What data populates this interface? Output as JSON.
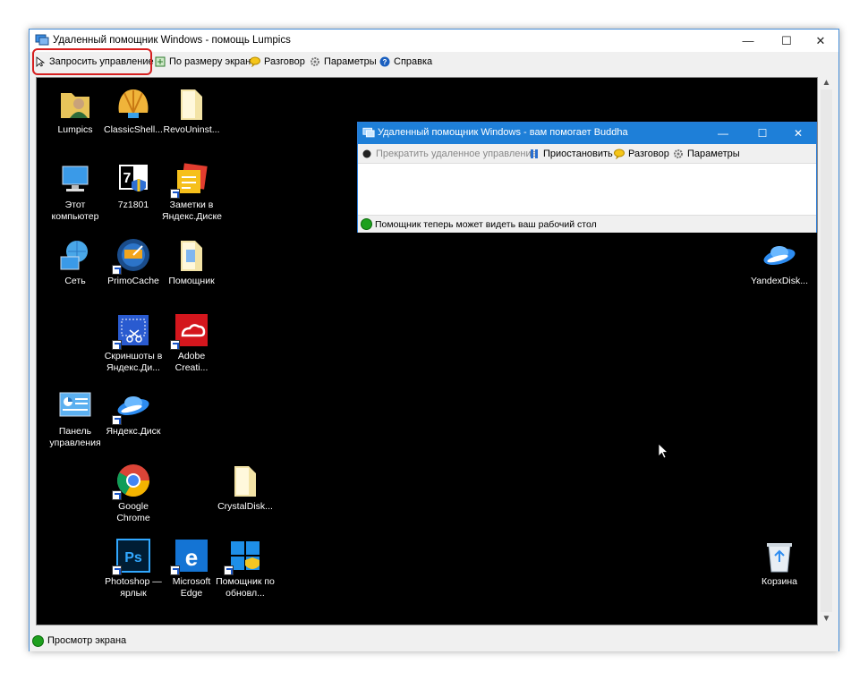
{
  "window": {
    "title": "Удаленный помощник Windows - помощь Lumpics",
    "minimize": "—",
    "maximize": "☐",
    "close": "✕"
  },
  "toolbar": {
    "request_control": "Запросить управление",
    "fit_screen": "По размеру экрана",
    "chat": "Разговор",
    "settings": "Параметры",
    "help": "Справка"
  },
  "status": {
    "text": "Просмотр экрана"
  },
  "desktop": {
    "icons": [
      {
        "label": "Lumpics"
      },
      {
        "label": "ClassicShell..."
      },
      {
        "label": "RevoUninst..."
      },
      {
        "label": "Этот компьютер"
      },
      {
        "label": "7z1801"
      },
      {
        "label": "Заметки в Яндекс.Диске"
      },
      {
        "label": "Сеть"
      },
      {
        "label": "PrimoCache"
      },
      {
        "label": "Помощник"
      },
      {
        "label": "Скриншоты в Яндекс.Ди..."
      },
      {
        "label": "Adobe Creati..."
      },
      {
        "label": "Панель управления"
      },
      {
        "label": "Яндекс.Диск"
      },
      {
        "label": "Google Chrome"
      },
      {
        "label": "CrystalDisk..."
      },
      {
        "label": "Photoshop — ярлык"
      },
      {
        "label": "Microsoft Edge"
      },
      {
        "label": "Помощник по обновл..."
      },
      {
        "label": "YandexDisk..."
      },
      {
        "label": "Корзина"
      }
    ]
  },
  "inner_window": {
    "title": "Удаленный помощник Windows - вам помогает Buddha",
    "stop_control": "Прекратить удаленное управление",
    "pause": "Приостановить",
    "chat": "Разговор",
    "settings": "Параметры",
    "status": "Помощник теперь может видеть ваш рабочий стол"
  },
  "colors": {
    "accent": "#1e7fd8",
    "highlight": "#d62020",
    "status_green": "#1ea01e",
    "desktop_bg": "#000000"
  }
}
